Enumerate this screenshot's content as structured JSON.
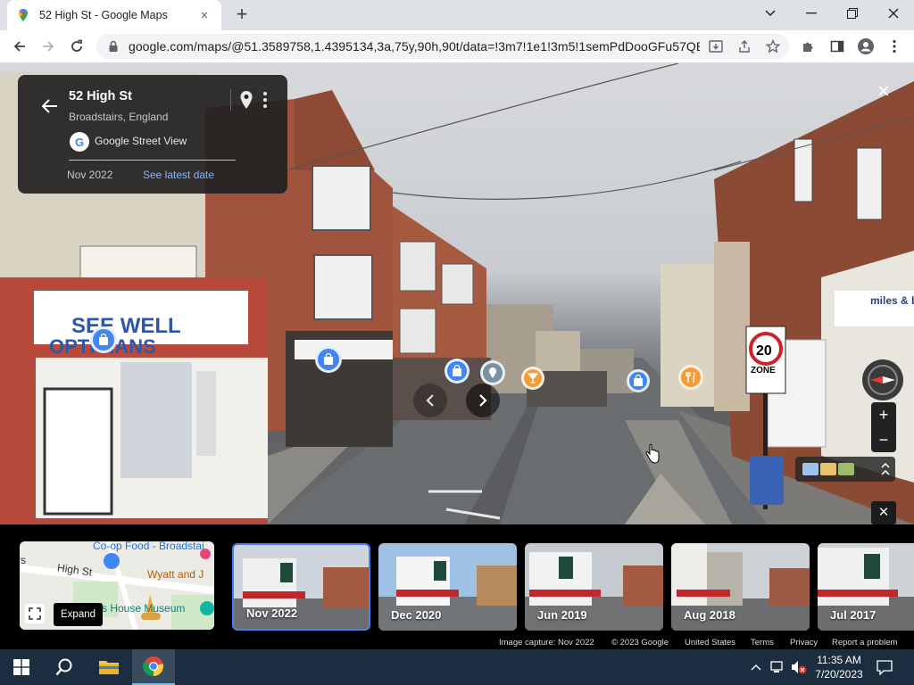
{
  "browser": {
    "tab_title": "52 High St - Google Maps",
    "tab_close": "×",
    "new_tab": "+",
    "url": "google.com/maps/@51.3589758,1.4395134,3a,75y,90h,90t/data=!3m7!1e1!3m5!1semPdDooGFu57QB..."
  },
  "infocard": {
    "title": "52 High St",
    "subtitle": "Broadstairs, England",
    "source_logo": "G",
    "source": "Google Street View",
    "date": "Nov 2022",
    "latest_link": "See latest date"
  },
  "streetview": {
    "close": "×",
    "zoom_in": "+",
    "zoom_out": "−",
    "close_strip": "×",
    "scene_text": {
      "shop_sign_1": "SEE WELL",
      "shop_sign_2": "OPTICIANS",
      "speed_limit": "20",
      "speed_zone": "ZONE",
      "agent_sign": "miles & ba"
    }
  },
  "minimap": {
    "labels": {
      "food": "Co-op Food - Broadstai",
      "street": "High St",
      "wyatt": "Wyatt and J",
      "museum": "s House Museum",
      "edge": "rs"
    },
    "expand_tooltip": "Expand"
  },
  "timeline": [
    {
      "label": "Nov 2022",
      "selected": true
    },
    {
      "label": "Dec 2020",
      "selected": false
    },
    {
      "label": "Jun 2019",
      "selected": false
    },
    {
      "label": "Aug 2018",
      "selected": false
    },
    {
      "label": "Jul 2017",
      "selected": false
    }
  ],
  "footer": {
    "capture": "Image capture: Nov 2022",
    "copyright": "© 2023 Google",
    "country": "United States",
    "terms": "Terms",
    "privacy": "Privacy",
    "report": "Report a problem"
  },
  "taskbar": {
    "time": "11:35 AM",
    "date": "7/20/2023"
  },
  "colors": {
    "accent_blue": "#4285f4",
    "link_blue": "#8ab4f8",
    "taskbar": "#1b2d3f"
  }
}
